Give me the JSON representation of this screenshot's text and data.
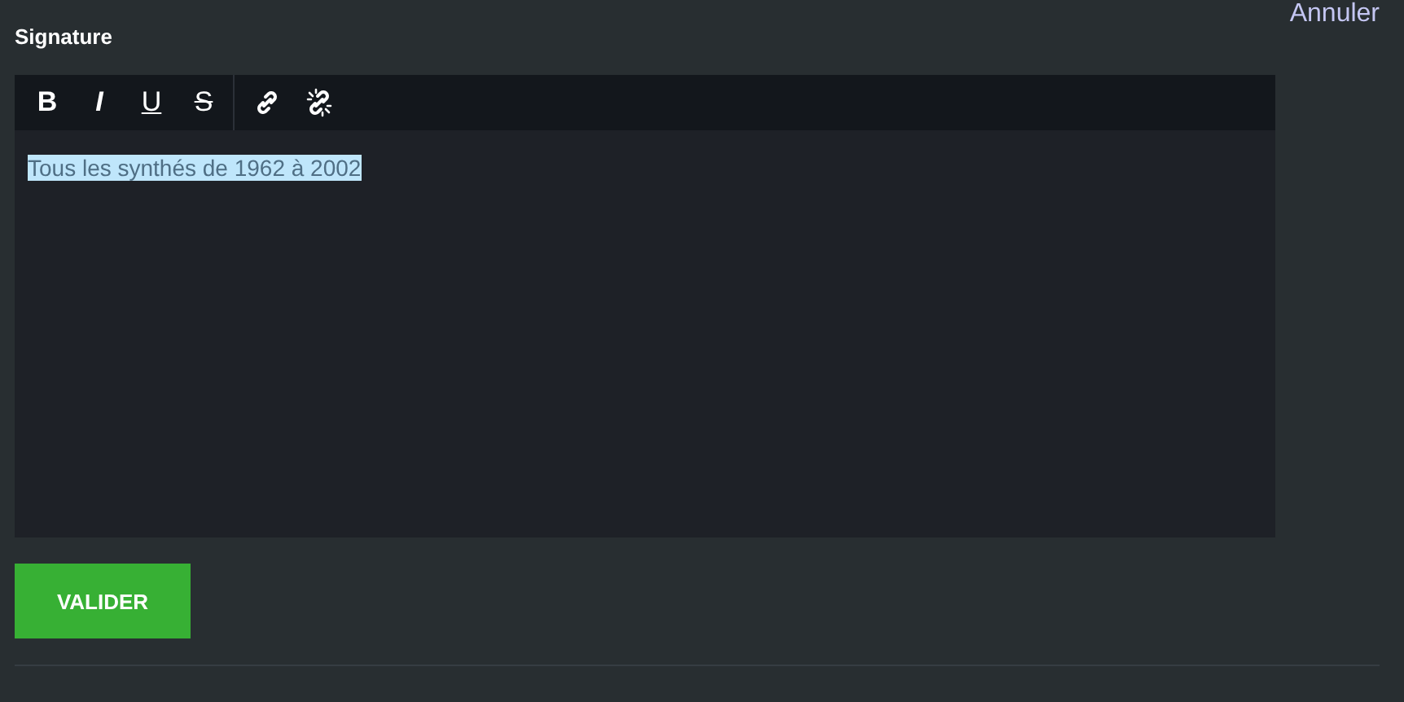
{
  "header": {
    "title": "Signature",
    "cancel_link": "Annuler"
  },
  "toolbar": [
    {
      "kind": "bold",
      "label": "B"
    },
    {
      "kind": "italic",
      "label": "I"
    },
    {
      "kind": "underline",
      "label": "U"
    },
    {
      "kind": "strike",
      "label": "S"
    },
    {
      "kind": "link"
    },
    {
      "kind": "unlink"
    }
  ],
  "editor": {
    "value": "Tous les synthés de 1962 à 2002",
    "selected": true
  },
  "buttons": [
    "VALIDER"
  ]
}
